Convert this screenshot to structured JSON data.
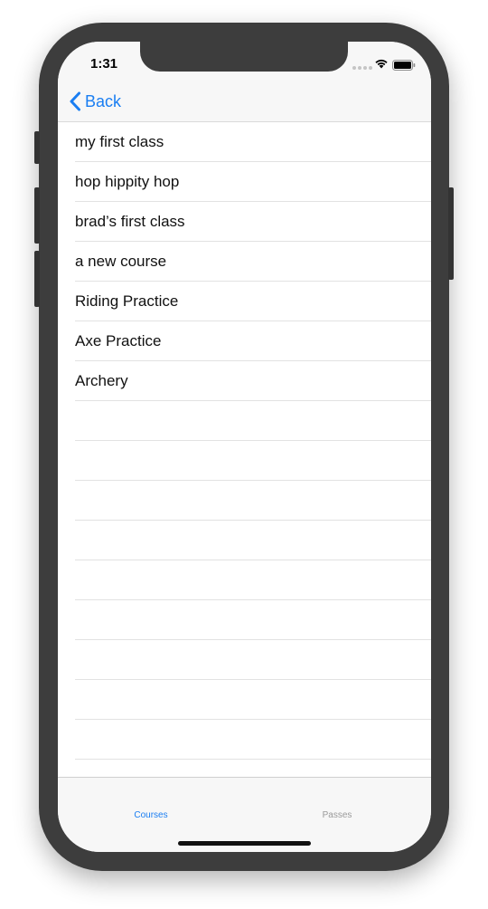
{
  "status_bar": {
    "time": "1:31",
    "signal_icon": "signal-dots-icon",
    "wifi_icon": "wifi-icon",
    "battery_icon": "battery-icon"
  },
  "nav": {
    "back_label": "Back",
    "back_icon": "chevron-left-icon"
  },
  "courses": [
    "my first class",
    "hop hippity hop",
    "brad’s first class",
    "a new course",
    "Riding Practice",
    "Axe Practice",
    "Archery"
  ],
  "tabs": [
    {
      "label": "Courses",
      "selected": true
    },
    {
      "label": "Passes",
      "selected": false
    }
  ],
  "colors": {
    "accent": "#1a7ef2",
    "bar_background": "#f7f7f7",
    "inactive_tab": "#9a9a9a",
    "separator": "#e2e2e2"
  }
}
